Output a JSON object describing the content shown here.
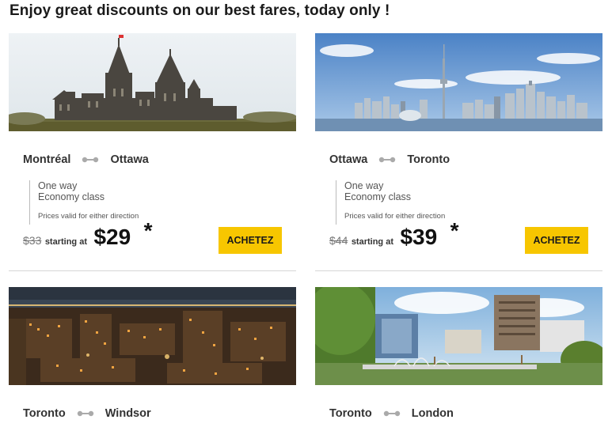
{
  "header": {
    "title": "Enjoy great discounts on our best fares, today only !"
  },
  "colors": {
    "accent": "#f7c600",
    "divider": "#d6d6d6"
  },
  "cards": [
    {
      "photo_icon": "parliament-photo",
      "from": "Montréal",
      "to": "Ottawa",
      "trip_type": "One way",
      "class": "Economy class",
      "validity": "Prices valid for either direction",
      "old_price": "$33",
      "starting": "starting at",
      "price": "$29",
      "asterisk": "*",
      "button": "ACHETEZ"
    },
    {
      "photo_icon": "toronto-skyline-photo",
      "from": "Ottawa",
      "to": "Toronto",
      "trip_type": "One way",
      "class": "Economy class",
      "validity": "Prices valid for either direction",
      "old_price": "$44",
      "starting": "starting at",
      "price": "$39",
      "asterisk": "*",
      "button": "ACHETEZ"
    },
    {
      "photo_icon": "night-city-photo",
      "from": "Toronto",
      "to": "Windsor"
    },
    {
      "photo_icon": "london-park-photo",
      "from": "Toronto",
      "to": "London"
    }
  ]
}
